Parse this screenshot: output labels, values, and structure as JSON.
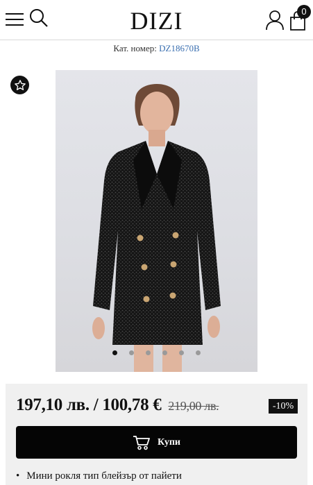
{
  "header": {
    "logo": "DIZI",
    "cart_count": "0",
    "icons": [
      "menu-icon",
      "search-icon",
      "user-icon",
      "shopping-bag-icon"
    ]
  },
  "product": {
    "sku_label": "Кат. номер:",
    "sku_value": "DZ18670B",
    "carousel": {
      "total": 6,
      "active": 1
    }
  },
  "pricing": {
    "price_text": "197,10 лв. / 100,78 €",
    "old_price": "219,00 лв.",
    "discount": "-10%",
    "buy_label": "Купи"
  },
  "features": [
    "Мини рокля тип блейзър от пайети"
  ],
  "colors": {
    "accent": "#111111",
    "sku_link": "#3a6fb0",
    "panel_bg": "#f0f0f0"
  }
}
